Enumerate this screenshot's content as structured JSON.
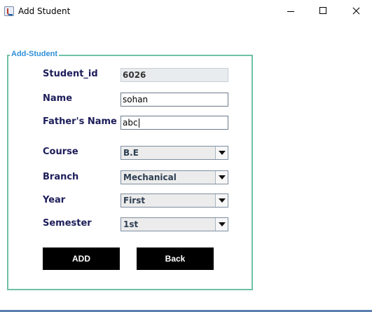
{
  "window": {
    "title": "Add Student",
    "icon": "java-cup-icon",
    "controls": [
      "minimize-icon",
      "maximize-icon",
      "close-icon"
    ]
  },
  "form": {
    "legend": "Add-Student",
    "border_color": "#6fc0a6",
    "legend_color": "#2f8fd8",
    "student_id": {
      "label": "Student_id",
      "value": "6026",
      "editable": false
    },
    "name": {
      "label": "Name",
      "value": "sohan"
    },
    "father_name": {
      "label": "Father's Name",
      "value": "abc"
    },
    "course": {
      "label": "Course",
      "selected": "B.E"
    },
    "branch": {
      "label": "Branch",
      "selected": "Mechanical"
    },
    "year": {
      "label": "Year",
      "selected": "First"
    },
    "semester": {
      "label": "Semester",
      "selected": "1st"
    },
    "buttons": {
      "add": "ADD",
      "back": "Back"
    },
    "label_color": "#1d1d5a",
    "button_color": "#000000"
  }
}
